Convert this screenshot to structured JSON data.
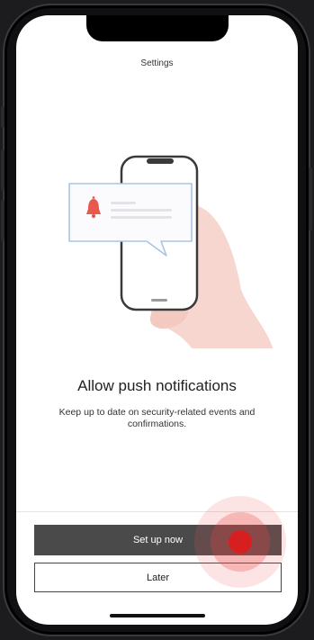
{
  "header": {
    "title": "Settings"
  },
  "illustration": {
    "bell_icon": "bell-icon",
    "accent_color": "#e8584f",
    "hand_color": "#f6d6cf"
  },
  "content": {
    "title": "Allow push notifications",
    "description": "Keep up to date on security-related events and confirmations."
  },
  "actions": {
    "primary_label": "Set up now",
    "secondary_label": "Later"
  },
  "colors": {
    "primary_button": "#4a4a4a",
    "tap_indicator": "#d81f1f"
  }
}
